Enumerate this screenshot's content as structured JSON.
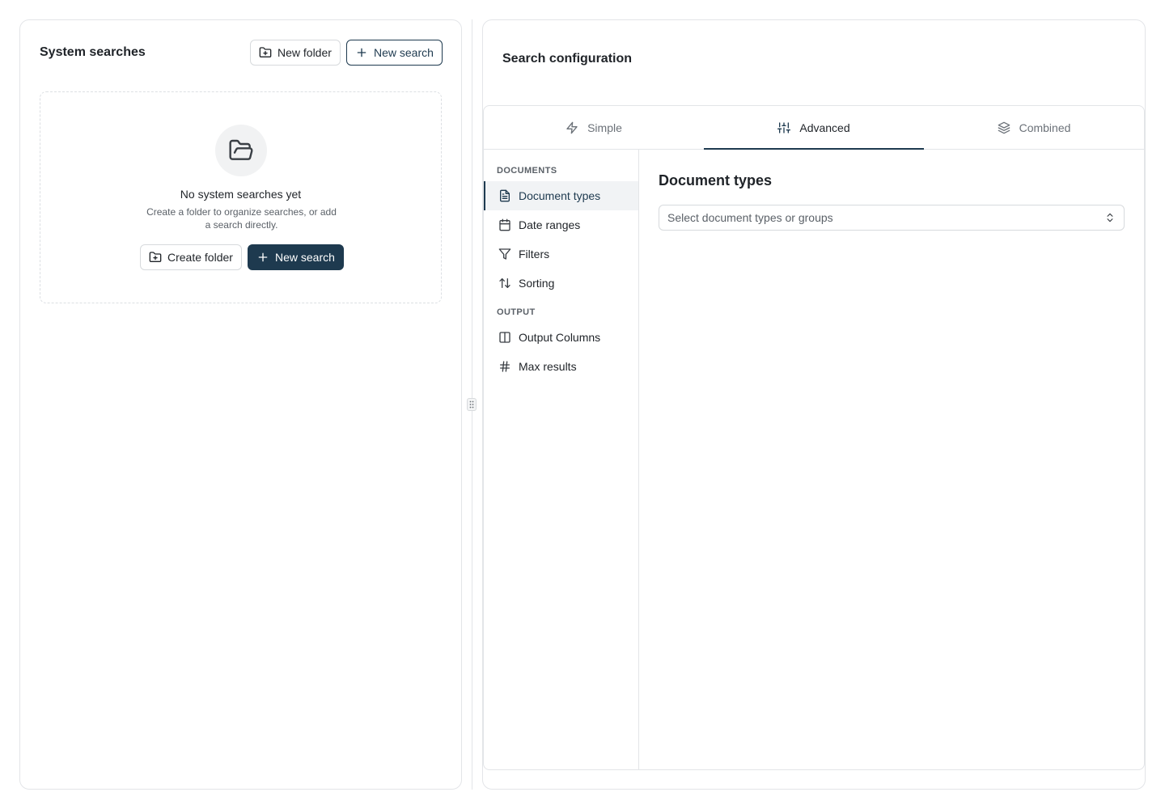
{
  "left_panel": {
    "title": "System searches",
    "new_folder_label": "New folder",
    "new_search_label": "New search",
    "empty_state": {
      "title": "No system searches yet",
      "description": "Create a folder to organize searches, or add a search directly.",
      "create_folder_label": "Create folder",
      "new_search_label": "New search"
    }
  },
  "right_panel": {
    "title": "Search configuration",
    "tabs": [
      {
        "label": "Simple",
        "icon": "lightning-icon"
      },
      {
        "label": "Advanced",
        "icon": "sliders-icon",
        "active": true
      },
      {
        "label": "Combined",
        "icon": "layers-icon"
      }
    ],
    "sidebar": {
      "sections": [
        {
          "label": "DOCUMENTS",
          "items": [
            {
              "label": "Document types",
              "icon": "document-icon",
              "active": true
            },
            {
              "label": "Date ranges",
              "icon": "calendar-icon"
            },
            {
              "label": "Filters",
              "icon": "filter-icon"
            },
            {
              "label": "Sorting",
              "icon": "sort-icon"
            }
          ]
        },
        {
          "label": "OUTPUT",
          "items": [
            {
              "label": "Output Columns",
              "icon": "columns-icon"
            },
            {
              "label": "Max results",
              "icon": "hash-icon"
            }
          ]
        }
      ]
    },
    "content": {
      "title": "Document types",
      "select_placeholder": "Select document types or groups"
    }
  },
  "colors": {
    "primary": "#1e3a4f",
    "border": "#e3e5e8",
    "muted_text": "#5b6168"
  }
}
